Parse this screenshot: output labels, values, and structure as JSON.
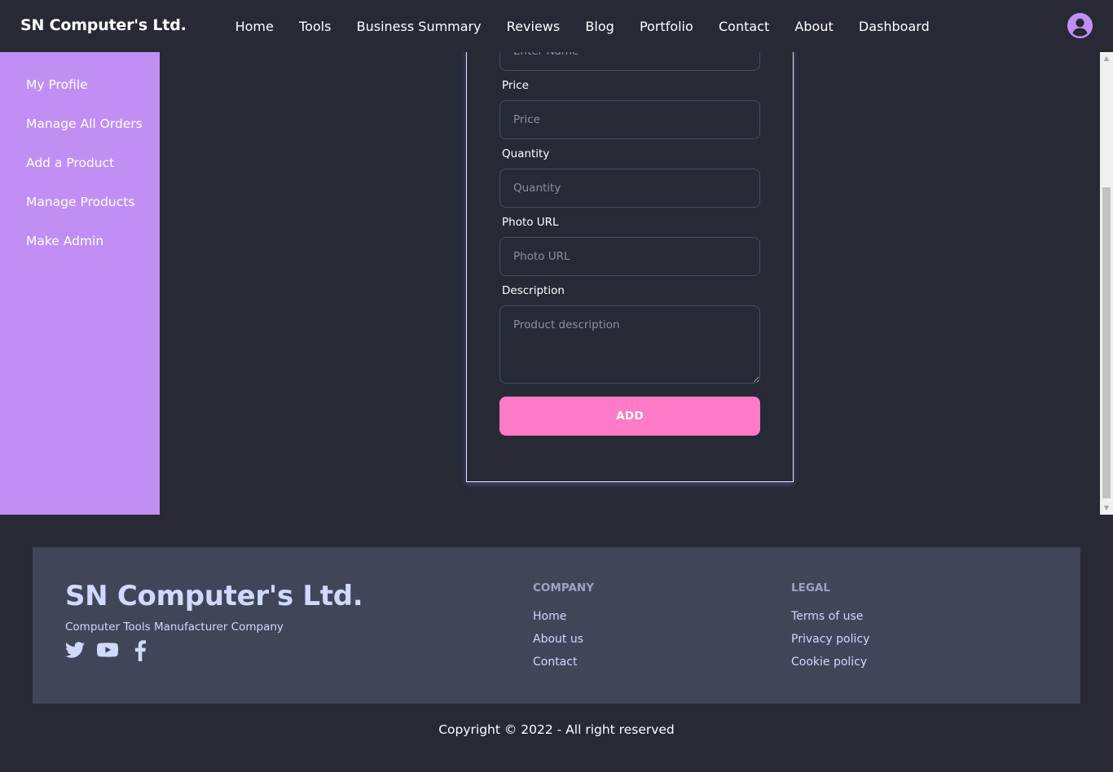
{
  "navbar": {
    "brand": "SN Computer's Ltd.",
    "links": [
      "Home",
      "Tools",
      "Business Summary",
      "Reviews",
      "Blog",
      "Portfolio",
      "Contact",
      "About",
      "Dashboard"
    ]
  },
  "sidebar": {
    "items": [
      "My Profile",
      "Manage All Orders",
      "Add a Product",
      "Manage Products",
      "Make Admin"
    ]
  },
  "form": {
    "name_placeholder": "Enter Name",
    "price_label": "Price",
    "price_placeholder": "Price",
    "quantity_label": "Quantity",
    "quantity_placeholder": "Quantity",
    "photo_label": "Photo URL",
    "photo_placeholder": "Photo URL",
    "description_label": "Description",
    "description_placeholder": "Product description",
    "submit_label": "ADD"
  },
  "footer": {
    "brand": "SN Computer's Ltd.",
    "tagline": "Computer Tools Manufacturer Company",
    "social_icons": [
      "twitter-icon",
      "youtube-icon",
      "facebook-icon"
    ],
    "company": {
      "heading": "COMPANY",
      "links": [
        "Home",
        "About us",
        "Contact"
      ]
    },
    "legal": {
      "heading": "LEGAL",
      "links": [
        "Terms of use",
        "Privacy policy",
        "Cookie policy"
      ]
    },
    "copyright": "Copyright © 2022 - All right reserved"
  },
  "colors": {
    "background": "#272935",
    "sidebar": "#c18ff4",
    "accent_button": "#ff7ac6",
    "footer_bg": "#414558",
    "footer_text": "#d0d9ff"
  }
}
